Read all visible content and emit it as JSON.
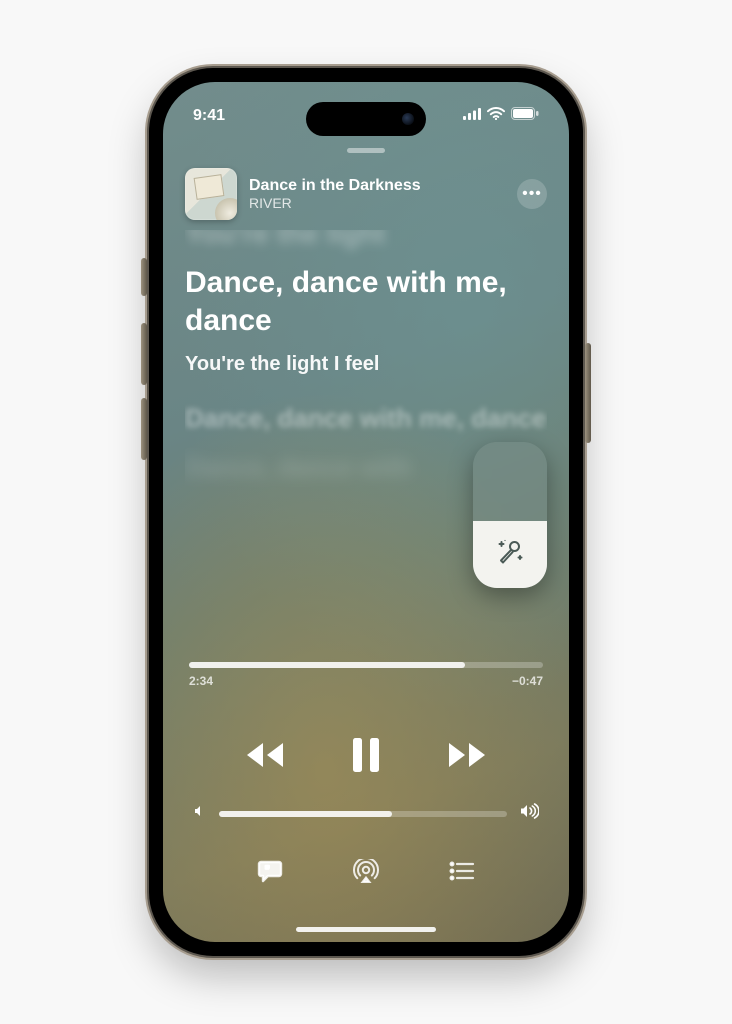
{
  "status": {
    "time": "9:41"
  },
  "header": {
    "title": "Dance in the Darkness",
    "artist": "RIVER",
    "more_label": "•••"
  },
  "lyrics": {
    "prev_clipped": "You're the light",
    "current": "Dance, dance with me, dance",
    "next": "You're the light I feel",
    "later": "Dance, dance with me, dance",
    "far": "Dance, dance with"
  },
  "karaoke": {
    "icon_name": "mic-sparkle-icon",
    "level_pct": 46
  },
  "playback": {
    "elapsed": "2:34",
    "remaining": "−0:47",
    "progress_pct": 78
  },
  "volume": {
    "level_pct": 60
  },
  "icons": {
    "signal": "signal-icon",
    "wifi": "wifi-icon",
    "battery": "battery-icon",
    "previous": "skip-back-icon",
    "pause": "pause-icon",
    "next": "skip-forward-icon",
    "speaker_low": "speaker-low-icon",
    "speaker_high": "speaker-high-icon",
    "lyrics_btn": "lyrics-view-icon",
    "airplay_btn": "airplay-icon",
    "queue_btn": "queue-list-icon"
  }
}
